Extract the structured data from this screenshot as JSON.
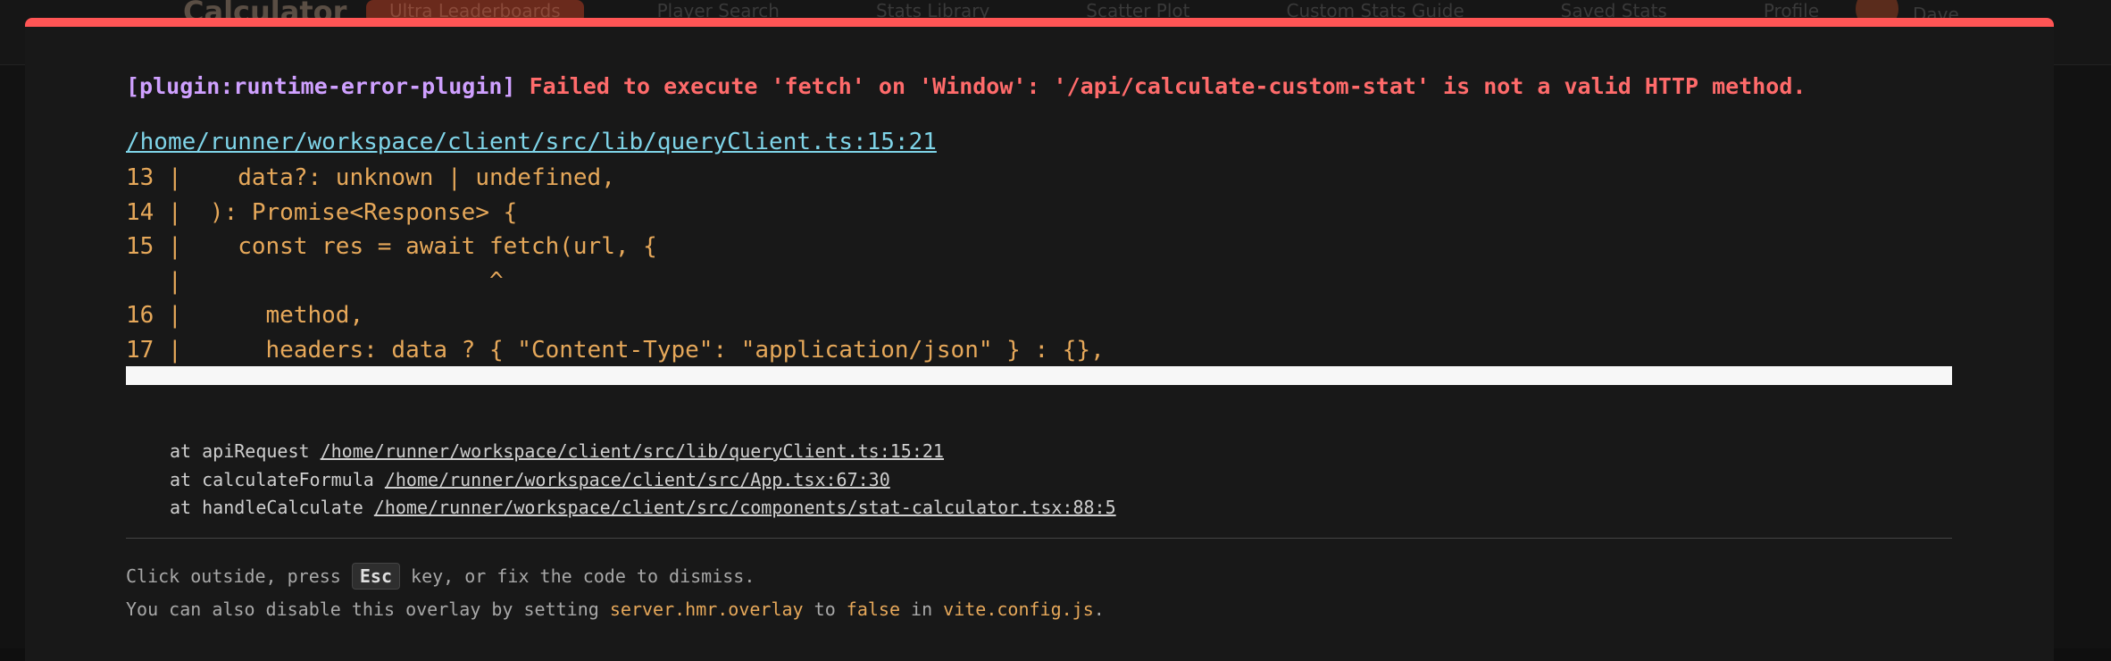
{
  "app": {
    "logo": "Calculator",
    "nav": [
      {
        "label": "Ultra Leaderboards",
        "icon": "trophy-icon"
      },
      {
        "label": "Player Search",
        "icon": "search-icon"
      },
      {
        "label": "Stats Library",
        "icon": "book-icon"
      },
      {
        "label": "Scatter Plot",
        "icon": "trend-icon"
      },
      {
        "label": "Custom Stats Guide",
        "icon": "doc-icon"
      },
      {
        "label": "Saved Stats",
        "icon": "heart-icon"
      },
      {
        "label": "Profile",
        "icon": "user-icon"
      }
    ],
    "user": "Dave"
  },
  "overlay": {
    "plugin": "[plugin:runtime-error-plugin]",
    "message": "Failed to execute 'fetch' on 'Window': '/api/calculate-custom-stat' is not a valid HTTP method.",
    "file": "/home/runner/workspace/client/src/lib/queryClient.ts:15:21",
    "frame": "13 |    data?: unknown | undefined,\n14 |  ): Promise<Response> {\n15 |    const res = await fetch(url, {\n   |                      ^\n16 |      method,\n17 |      headers: data ? { \"Content-Type\": \"application/json\" } : {},",
    "stack": [
      {
        "fn": "at apiRequest",
        "loc": "/home/runner/workspace/client/src/lib/queryClient.ts:15:21"
      },
      {
        "fn": "at calculateFormula",
        "loc": "/home/runner/workspace/client/src/App.tsx:67:30"
      },
      {
        "fn": "at handleCalculate",
        "loc": "/home/runner/workspace/client/src/components/stat-calculator.tsx:88:5"
      }
    ],
    "tip1_a": "Click outside, press ",
    "tip1_key": "Esc",
    "tip1_b": " key, or fix the code to dismiss.",
    "tip2_a": "You can also disable this overlay by setting ",
    "tip2_setting": "server.hmr.overlay",
    "tip2_b": " to ",
    "tip2_value": "false",
    "tip2_c": " in ",
    "tip2_file": "vite.config.js",
    "tip2_d": "."
  },
  "colors": {
    "accent_bar": "#ff5555",
    "plugin": "#cfa0ff",
    "error": "#ff6b6b",
    "file_link": "#7fd4e8",
    "code": "#e6a85a"
  }
}
